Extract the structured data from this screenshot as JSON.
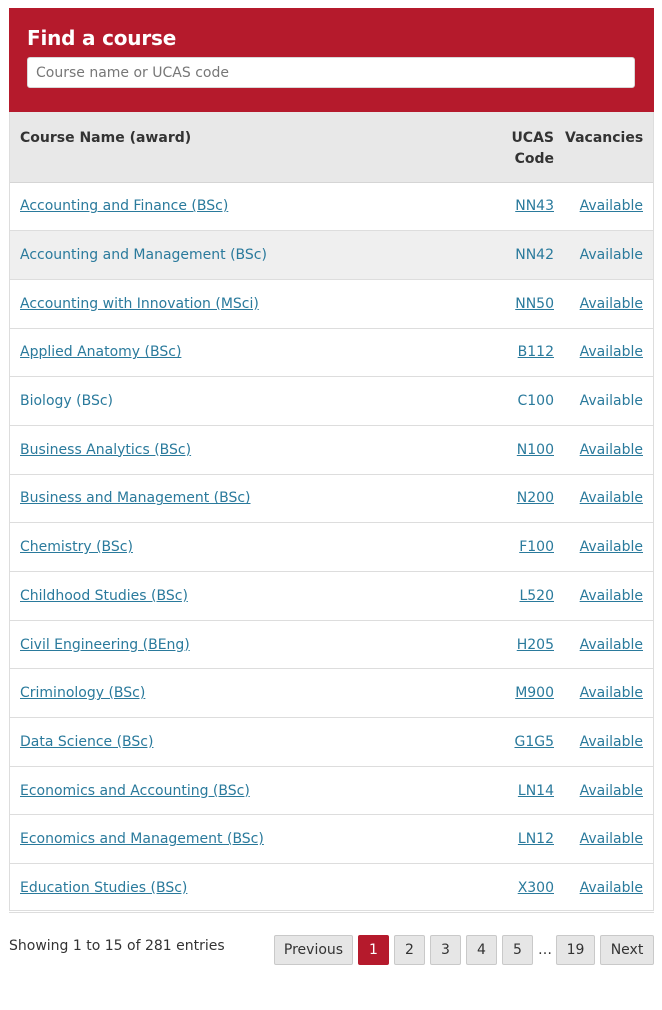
{
  "search": {
    "title": "Find a course",
    "placeholder": "Course name or UCAS code",
    "value": ""
  },
  "table": {
    "headers": {
      "course": "Course Name (award)",
      "ucas_line1": "UCAS",
      "ucas_line2": "Code",
      "vacancies": "Vacancies"
    },
    "rows": [
      {
        "course": "Accounting and Finance (BSc)",
        "ucas": "NN43",
        "vacancies": "Available"
      },
      {
        "course": "Accounting and Management (BSc)",
        "ucas": "NN42",
        "vacancies": "Available"
      },
      {
        "course": "Accounting with Innovation (MSci)",
        "ucas": "NN50",
        "vacancies": "Available"
      },
      {
        "course": "Applied Anatomy (BSc)",
        "ucas": "B112",
        "vacancies": "Available"
      },
      {
        "course": "Biology (BSc)",
        "ucas": "C100",
        "vacancies": "Available"
      },
      {
        "course": "Business Analytics (BSc)",
        "ucas": "N100",
        "vacancies": "Available"
      },
      {
        "course": "Business and Management (BSc)",
        "ucas": "N200",
        "vacancies": "Available"
      },
      {
        "course": "Chemistry (BSc)",
        "ucas": "F100",
        "vacancies": "Available"
      },
      {
        "course": "Childhood Studies (BSc)",
        "ucas": "L520",
        "vacancies": "Available"
      },
      {
        "course": "Civil Engineering (BEng)",
        "ucas": "H205",
        "vacancies": "Available"
      },
      {
        "course": "Criminology (BSc)",
        "ucas": "M900",
        "vacancies": "Available"
      },
      {
        "course": "Data Science (BSc)",
        "ucas": "G1G5",
        "vacancies": "Available"
      },
      {
        "course": "Economics and Accounting (BSc)",
        "ucas": "LN14",
        "vacancies": "Available"
      },
      {
        "course": "Economics and Management (BSc)",
        "ucas": "LN12",
        "vacancies": "Available"
      },
      {
        "course": "Education Studies (BSc)",
        "ucas": "X300",
        "vacancies": "Available"
      }
    ]
  },
  "footer": {
    "info": "Showing 1 to 15 of 281 entries",
    "previous": "Previous",
    "pages": [
      "1",
      "2",
      "3",
      "4",
      "5"
    ],
    "current_page": "1",
    "ellipsis": "…",
    "last_page": "19",
    "next": "Next"
  },
  "colors": {
    "brand": "#b51a2c",
    "link": "#2a7a9c",
    "header_bg": "#e8e8e8"
  }
}
